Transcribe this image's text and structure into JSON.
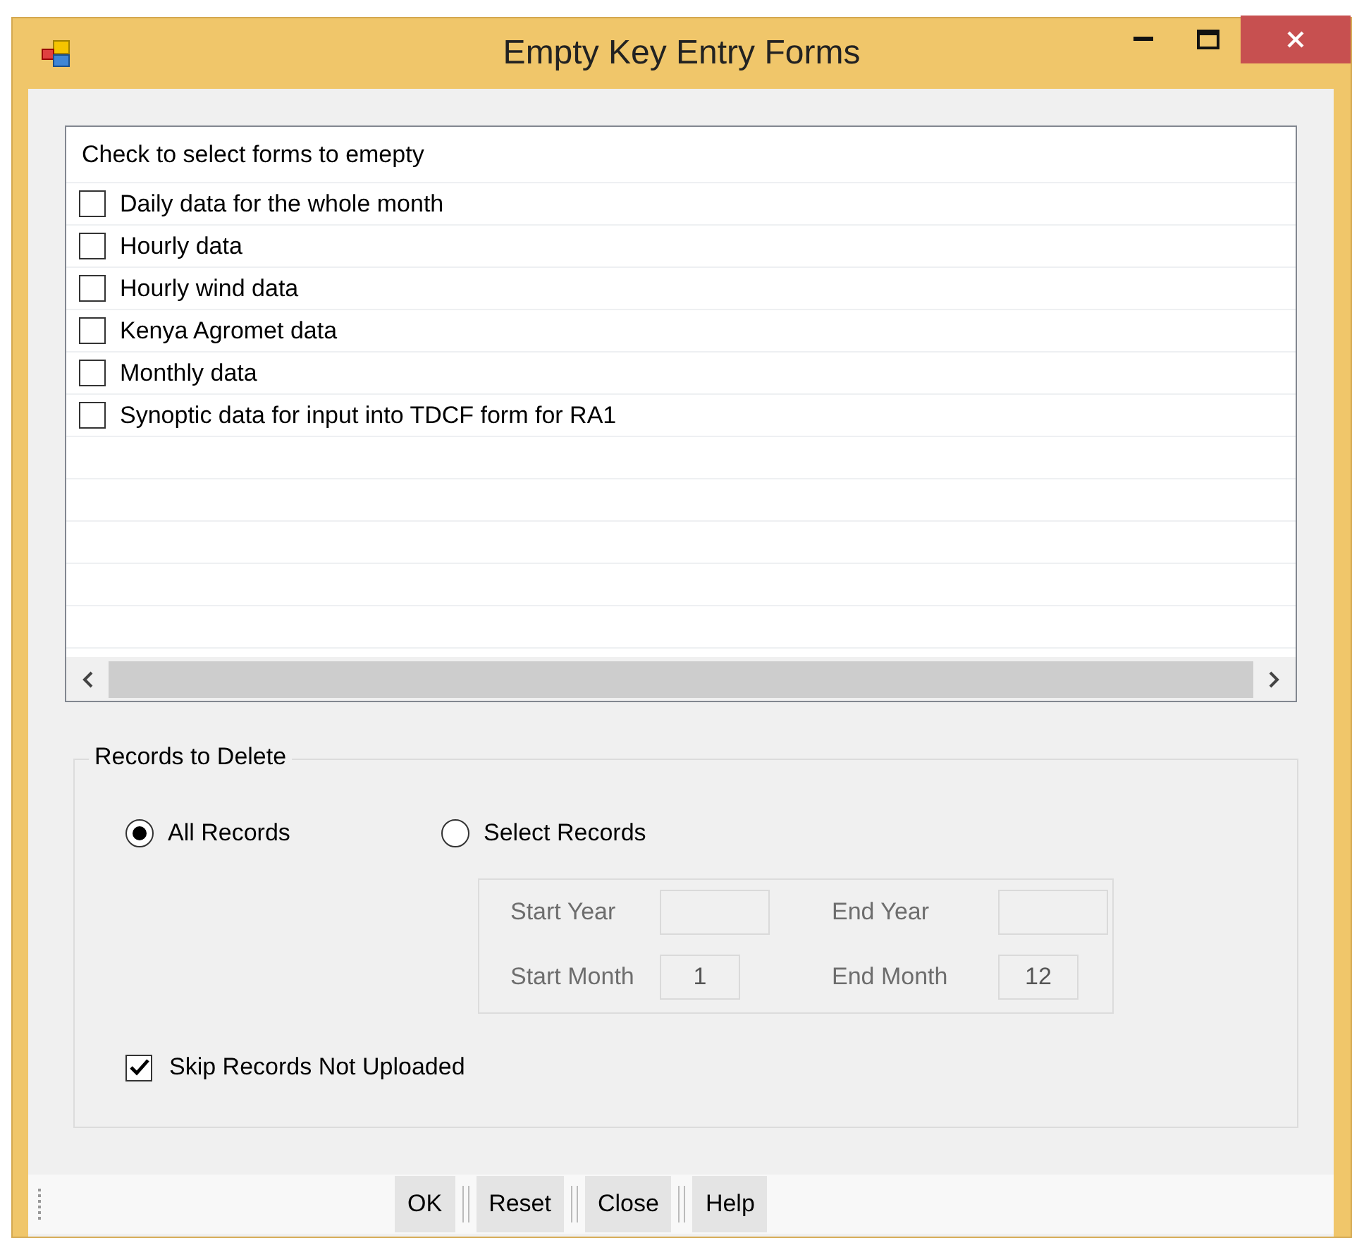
{
  "window": {
    "title": "Empty Key Entry Forms"
  },
  "forms_list": {
    "header": "Check to select  forms to emepty",
    "items": [
      {
        "label": "Daily data for the whole month",
        "checked": false
      },
      {
        "label": "Hourly data",
        "checked": false
      },
      {
        "label": "Hourly wind data",
        "checked": false
      },
      {
        "label": "Kenya Agromet data",
        "checked": false
      },
      {
        "label": "Monthly data",
        "checked": false
      },
      {
        "label": "Synoptic data for input into TDCF form for RA1",
        "checked": false
      }
    ]
  },
  "records_group": {
    "title": "Records to Delete",
    "options": [
      {
        "label": "All Records",
        "selected": true
      },
      {
        "label": "Select Records",
        "selected": false
      }
    ],
    "range": {
      "disabled": true,
      "fields": [
        {
          "label": "Start Year"
        },
        {
          "label": "End Year"
        },
        {
          "label": "Start Month",
          "value": "1"
        },
        {
          "label": "End Month",
          "value": "12"
        }
      ]
    },
    "skip_not_uploaded": {
      "label": "Skip Records Not Uploaded",
      "checked": true
    }
  },
  "toolbar": {
    "buttons": [
      "OK",
      "Reset",
      "Close",
      "Help"
    ]
  }
}
